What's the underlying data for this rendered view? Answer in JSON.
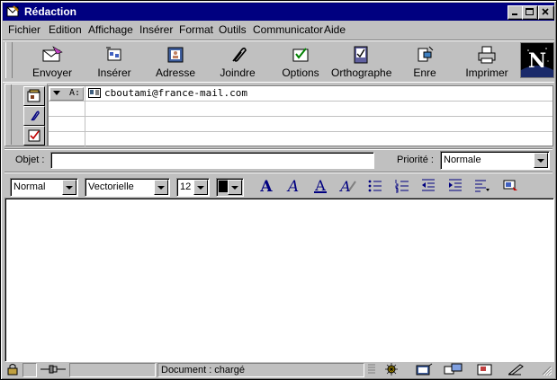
{
  "window": {
    "title": "Rédaction",
    "controls": [
      "minimize-icon",
      "maximize-icon",
      "close-icon"
    ]
  },
  "menu": [
    "Fichier",
    "Edition",
    "Affichage",
    "Insérer",
    "Format",
    "Outils",
    "Communicator",
    "Aide"
  ],
  "toolbar": [
    {
      "label": "Envoyer",
      "icon": "send-icon"
    },
    {
      "label": "Insérer",
      "icon": "quote-icon"
    },
    {
      "label": "Adresse",
      "icon": "address-book-icon"
    },
    {
      "label": "Joindre",
      "icon": "attach-icon"
    },
    {
      "label": "Options",
      "icon": "options-icon"
    },
    {
      "label": "Orthographe",
      "icon": "spellcheck-icon"
    },
    {
      "label": "Enre",
      "icon": "save-icon"
    },
    {
      "label": "Imprimer",
      "icon": "print-icon"
    }
  ],
  "brand": {
    "letter": "N",
    "icon": "netscape-logo-icon"
  },
  "address": {
    "rows": [
      {
        "type": "A:",
        "value": "cboutami@france-mail.com"
      },
      {
        "type": "",
        "value": ""
      },
      {
        "type": "",
        "value": ""
      },
      {
        "type": "",
        "value": ""
      }
    ]
  },
  "subject": {
    "label": "Objet :",
    "value": ""
  },
  "priority": {
    "label": "Priorité :",
    "value": "Normale"
  },
  "format": {
    "paragraph_style": "Normal",
    "font": "Vectorielle",
    "size": "12",
    "color": "#000000"
  },
  "status": {
    "text": "Document : chargé"
  },
  "colors": {
    "titlebar": "#000080",
    "face": "#c0c0c0",
    "netscape_star": "#3a5fd0"
  }
}
